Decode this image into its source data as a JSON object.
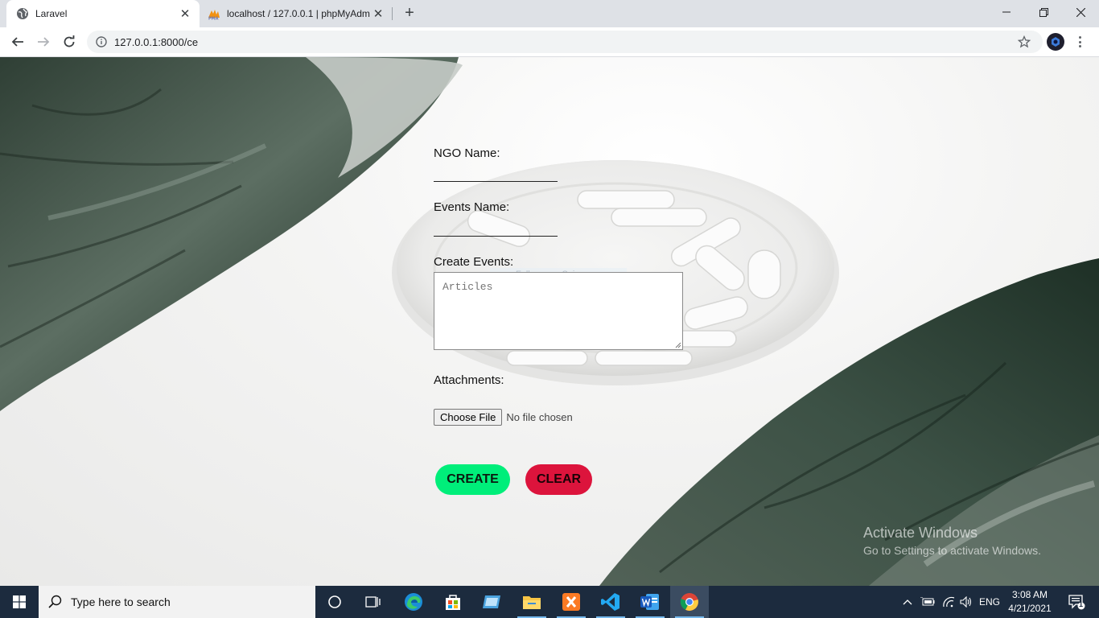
{
  "browser": {
    "tabs": [
      {
        "title": "Laravel",
        "icon": "globe-icon",
        "active": true
      },
      {
        "title": "localhost / 127.0.0.1 | phpMyAdm",
        "icon": "phpmyadmin-icon",
        "active": false
      }
    ],
    "url": "127.0.0.1:8000/ce"
  },
  "form": {
    "ngo_label": "NGO Name:",
    "events_label": "Events Name:",
    "create_events_label": "Create Events:",
    "create_events_placeholder": "Articles",
    "attachments_label": "Attachments:",
    "choose_file_label": "Choose File",
    "no_file_text": "No file chosen",
    "create_button": "CREATE",
    "clear_button": "CLEAR",
    "create_color": "#00ee7a",
    "clear_color": "#dc143c"
  },
  "overlay": {
    "snip_text": "Full-screen Snip"
  },
  "watermark": {
    "line1": "Activate Windows",
    "line2": "Go to Settings to activate Windows."
  },
  "taskbar": {
    "search_placeholder": "Type here to search",
    "apps": [
      "cortana-icon",
      "task-view-icon",
      "edge-icon",
      "store-icon",
      "app-icon",
      "file-explorer-icon",
      "xampp-icon",
      "vscode-icon",
      "word-icon",
      "chrome-icon"
    ],
    "language": "ENG",
    "time": "3:08 AM",
    "date": "4/21/2021",
    "notification_count": "1"
  }
}
